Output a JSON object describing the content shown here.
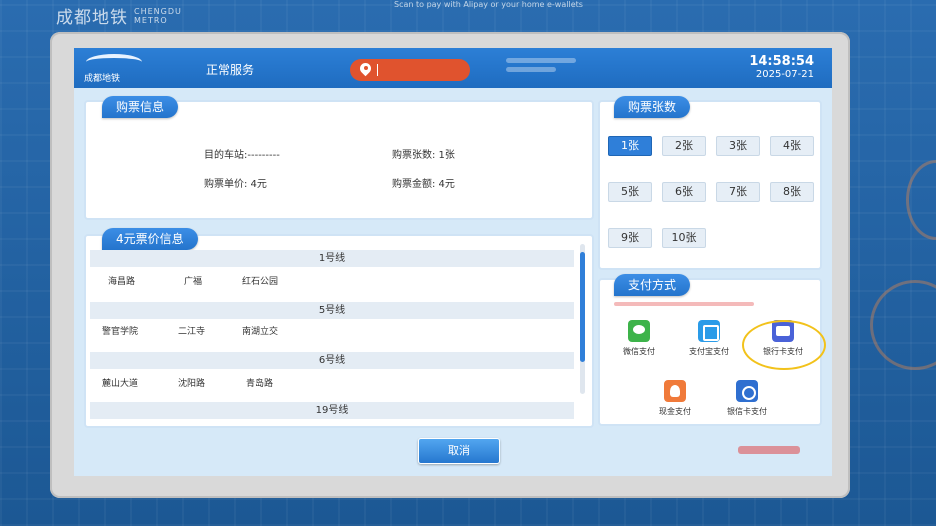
{
  "outer": {
    "brand_cn": "成都地铁",
    "brand_en_1": "CHENGDU",
    "brand_en_2": "METRO",
    "scan_hint": "Scan to pay with Alipay or your home e-wallets"
  },
  "header": {
    "logo_cn": "成都地铁",
    "service_status": "正常服务",
    "time": "14:58:54",
    "date": "2025-07-21"
  },
  "purchase_info": {
    "title": "购票信息",
    "destination_label": "目的车站:---------",
    "quantity_label": "购票张数: 1张",
    "unit_price_label": "购票单价: 4元",
    "total_label": "购票金额: 4元"
  },
  "fare_info": {
    "title": "4元票价信息",
    "lines": [
      {
        "name": "1号线",
        "stations": [
          "海昌路",
          "广福",
          "红石公园"
        ]
      },
      {
        "name": "5号线",
        "stations": [
          "警官学院",
          "二江寺",
          "南湖立交"
        ]
      },
      {
        "name": "6号线",
        "stations": [
          "麓山大道",
          "沈阳路",
          "青岛路"
        ]
      },
      {
        "name": "19号线",
        "stations": []
      }
    ]
  },
  "quantity": {
    "title": "购票张数",
    "selected_index": 0,
    "options": [
      "1张",
      "2张",
      "3张",
      "4张",
      "5张",
      "6张",
      "7张",
      "8张",
      "9张",
      "10张"
    ]
  },
  "payment": {
    "title": "支付方式",
    "methods": [
      {
        "label": "微信支付",
        "icon": "wechat-icon"
      },
      {
        "label": "支付宝支付",
        "icon": "alipay-icon"
      },
      {
        "label": "银行卡支付",
        "icon": "bank-card-icon"
      },
      {
        "label": "现金支付",
        "icon": "cash-icon"
      },
      {
        "label": "银信卡支付",
        "icon": "union-card-icon"
      }
    ],
    "highlighted_index": 2
  },
  "actions": {
    "cancel_label": "取消"
  },
  "colors": {
    "header": "#2c7fd6",
    "accent": "#2f7fd9",
    "station_pill": "#e0532e",
    "highlight_ring": "#f2c21b"
  }
}
